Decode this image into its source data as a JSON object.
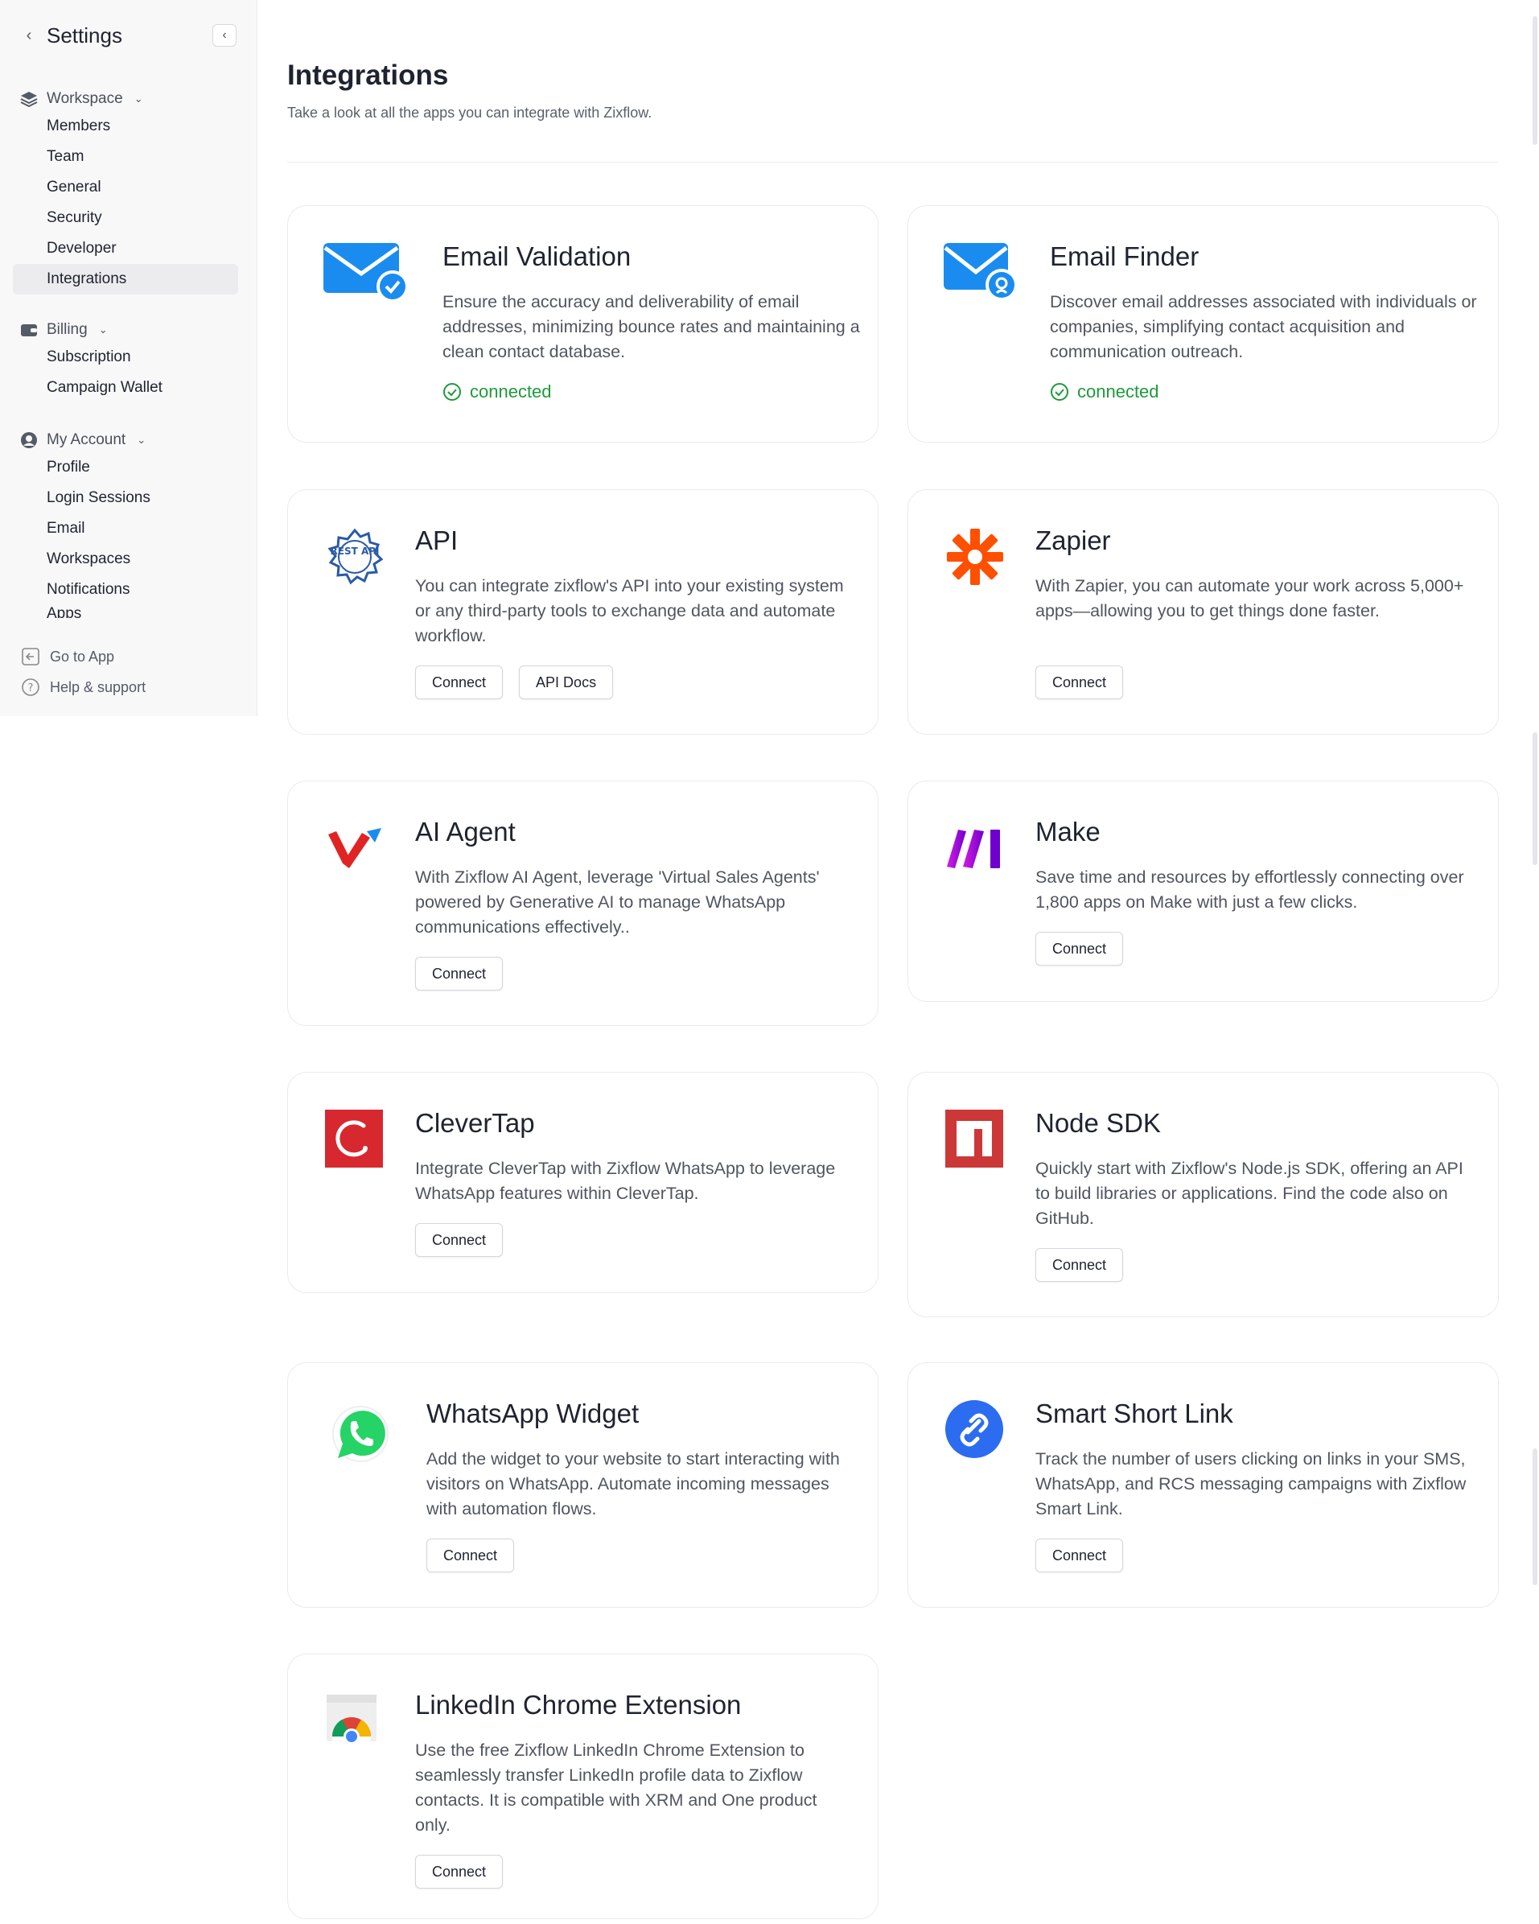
{
  "sidebar": {
    "title": "Settings",
    "groups": [
      {
        "label": "Workspace",
        "items": [
          "Members",
          "Team",
          "General",
          "Security",
          "Developer",
          "Integrations"
        ]
      },
      {
        "label": "Billing",
        "items": [
          "Subscription",
          "Campaign Wallet"
        ]
      },
      {
        "label": "My Account",
        "items": [
          "Profile",
          "Login Sessions",
          "Email",
          "Workspaces",
          "Notifications",
          "Apps"
        ]
      }
    ],
    "active_item": "Integrations",
    "footer": {
      "go_to_app": "Go to App",
      "help": "Help & support"
    }
  },
  "header": {
    "title": "Integrations",
    "subtitle": "Take a look at all the apps you can integrate with Zixflow."
  },
  "cards": [
    {
      "title": "Email Validation",
      "desc": "Ensure the accuracy and deliverability of email addresses, minimizing bounce rates and maintaining a clean contact database.",
      "status": "connected",
      "icon": "email-validation-icon"
    },
    {
      "title": "Email Finder",
      "desc": "Discover email addresses associated with individuals or companies, simplifying contact acquisition and communication outreach.",
      "status": "connected",
      "icon": "email-finder-icon"
    },
    {
      "title": "API",
      "desc": "You can integrate zixflow's API into your existing system or any third-party tools to exchange data and automate workflow.",
      "buttons": [
        "Connect",
        "API Docs"
      ],
      "icon": "rest-api-icon",
      "icon_text": "REST API"
    },
    {
      "title": "Zapier",
      "desc": "With Zapier, you can automate your work across 5,000+ apps—allowing you to get things done faster.",
      "buttons": [
        "Connect"
      ],
      "icon": "zapier-icon"
    },
    {
      "title": "AI Agent",
      "desc": "With Zixflow AI Agent, leverage 'Virtual Sales Agents' powered by Generative AI to manage WhatsApp communications effectively..",
      "buttons": [
        "Connect"
      ],
      "icon": "ai-agent-icon"
    },
    {
      "title": "Make",
      "desc": "Save time and resources by effortlessly connecting over 1,800 apps on Make with just a few clicks.",
      "buttons": [
        "Connect"
      ],
      "icon": "make-icon"
    },
    {
      "title": "CleverTap",
      "desc": "Integrate CleverTap with Zixflow WhatsApp to leverage WhatsApp features within CleverTap.",
      "buttons": [
        "Connect"
      ],
      "icon": "clevertap-icon"
    },
    {
      "title": "Node SDK",
      "desc": "Quickly start with Zixflow's Node.js SDK, offering an API to build libraries or applications. Find the code also on GitHub.",
      "buttons": [
        "Connect"
      ],
      "icon": "npm-icon"
    },
    {
      "title": "WhatsApp Widget",
      "desc": "Add the widget to your website to start interacting with visitors on WhatsApp. Automate incoming messages with automation flows.",
      "buttons": [
        "Connect"
      ],
      "icon": "whatsapp-icon"
    },
    {
      "title": "Smart Short Link",
      "desc": "Track the number of users clicking on links in your SMS, WhatsApp, and RCS messaging campaigns with Zixflow Smart Link.",
      "buttons": [
        "Connect"
      ],
      "icon": "link-icon"
    },
    {
      "title": "LinkedIn Chrome Extension",
      "desc": "Use the free Zixflow LinkedIn Chrome Extension to seamlessly transfer LinkedIn profile data to Zixflow contacts. It is compatible with XRM and One product only.",
      "buttons": [
        "Connect"
      ],
      "icon": "chrome-extension-icon"
    }
  ],
  "colors": {
    "connected": "#1e9a3a",
    "email_blue": "#1a8cf0",
    "zapier": "#ff4f00",
    "clevertap": "#d7282f",
    "npm": "#cb3837",
    "whatsapp": "#25d366",
    "link_blue": "#2b6cf0"
  }
}
